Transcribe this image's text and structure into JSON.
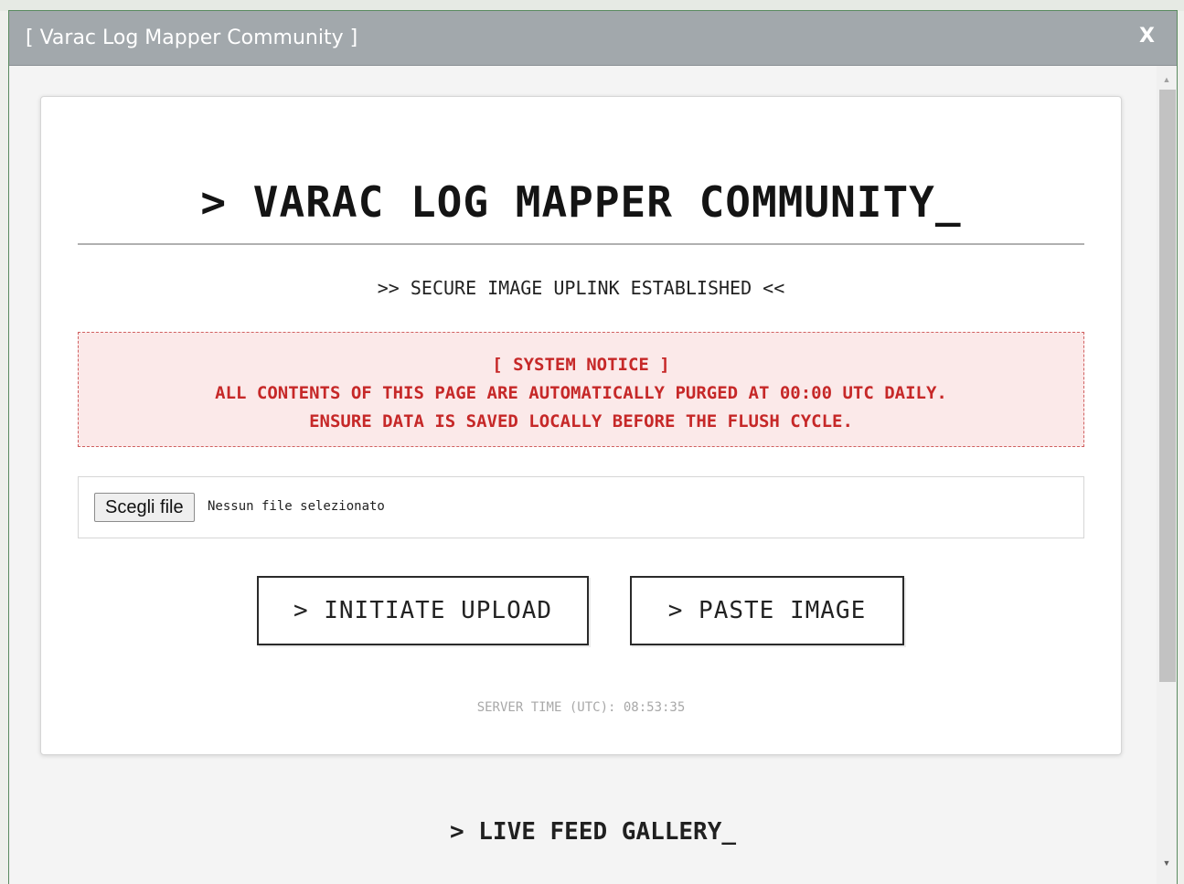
{
  "window": {
    "title": "[ Varac Log Mapper Community ]",
    "close_label": "X"
  },
  "header": {
    "title": "> VARAC LOG MAPPER COMMUNITY_",
    "subtitle": ">> SECURE IMAGE UPLINK ESTABLISHED <<"
  },
  "notice": {
    "heading": "[ SYSTEM NOTICE ]",
    "line1": "ALL CONTENTS OF THIS PAGE ARE AUTOMATICALLY PURGED AT 00:00 UTC DAILY.",
    "line2": "ENSURE DATA IS SAVED LOCALLY BEFORE THE FLUSH CYCLE."
  },
  "file_input": {
    "button_label": "Scegli file",
    "status": "Nessun file selezionato"
  },
  "actions": {
    "upload_label": "> INITIATE UPLOAD",
    "paste_label": "> PASTE IMAGE"
  },
  "server_time": "SERVER TIME (UTC): 08:53:35",
  "gallery": {
    "title": "> LIVE FEED GALLERY_"
  },
  "colors": {
    "titlebar": "#a2a8ac",
    "notice_text": "#c62828",
    "notice_bg": "#fbe9e9"
  }
}
